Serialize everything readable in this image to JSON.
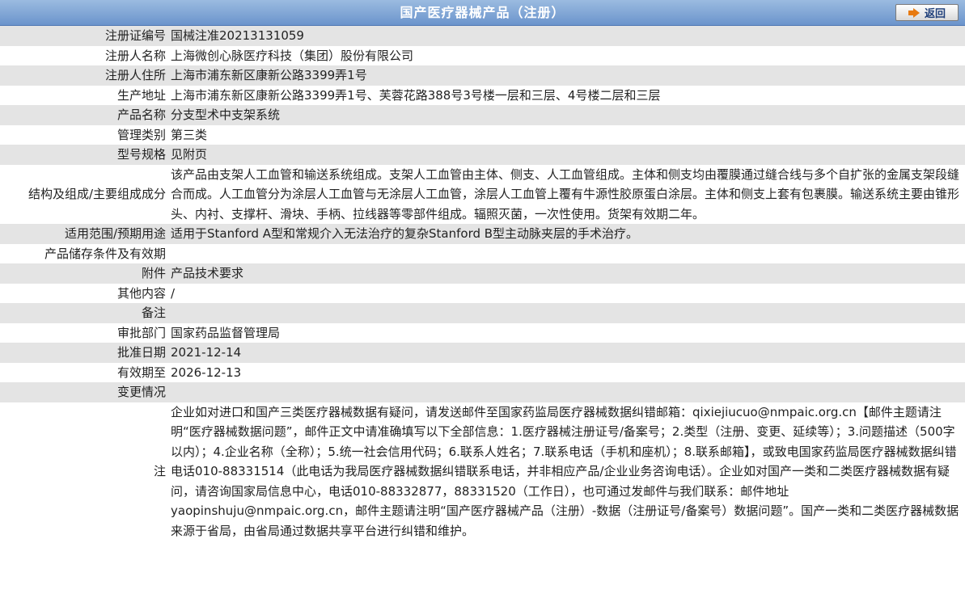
{
  "header": {
    "title": "国产医疗器械产品（注册）",
    "back_label": "返回",
    "back_icon": "arrow-right-icon"
  },
  "rows": [
    {
      "label": "注册证编号",
      "value": "国械注准20213131059"
    },
    {
      "label": "注册人名称",
      "value": "上海微创心脉医疗科技（集团）股份有限公司"
    },
    {
      "label": "注册人住所",
      "value": "上海市浦东新区康新公路3399弄1号"
    },
    {
      "label": "生产地址",
      "value": "上海市浦东新区康新公路3399弄1号、芙蓉花路388号3号楼一层和三层、4号楼二层和三层"
    },
    {
      "label": "产品名称",
      "value": "分支型术中支架系统"
    },
    {
      "label": "管理类别",
      "value": "第三类"
    },
    {
      "label": "型号规格",
      "value": "见附页"
    },
    {
      "label": "结构及组成/主要组成成分",
      "value": "该产品由支架人工血管和输送系统组成。支架人工血管由主体、侧支、人工血管组成。主体和侧支均由覆膜通过缝合线与多个自扩张的金属支架段缝合而成。人工血管分为涂层人工血管与无涂层人工血管，涂层人工血管上覆有牛源性胶原蛋白涂层。主体和侧支上套有包裹膜。输送系统主要由锥形头、内衬、支撑杆、滑块、手柄、拉线器等零部件组成。辐照灭菌，一次性使用。货架有效期二年。"
    },
    {
      "label": "适用范围/预期用途",
      "value": "适用于Stanford A型和常规介入无法治疗的复杂Stanford B型主动脉夹层的手术治疗。"
    },
    {
      "label": "产品储存条件及有效期",
      "value": ""
    },
    {
      "label": "附件",
      "value": "产品技术要求"
    },
    {
      "label": "其他内容",
      "value": "/"
    },
    {
      "label": "备注",
      "value": ""
    },
    {
      "label": "审批部门",
      "value": "国家药品监督管理局"
    },
    {
      "label": "批准日期",
      "value": "2021-12-14"
    },
    {
      "label": "有效期至",
      "value": "2026-12-13"
    },
    {
      "label": "变更情况",
      "value": ""
    }
  ],
  "footer_note": {
    "label": "注",
    "text": "企业如对进口和国产三类医疗器械数据有疑问，请发送邮件至国家药监局医疗器械数据纠错邮箱：qixiejiucuo@nmpaic.org.cn【邮件主题请注明“医疗器械数据问题”，邮件正文中请准确填写以下全部信息：1.医疗器械注册证号/备案号；2.类型（注册、变更、延续等）；3.问题描述（500字以内）；4.企业名称（全称）；5.统一社会信用代码；6.联系人姓名；7.联系电话（手机和座机）；8.联系邮箱】，或致电国家药监局医疗器械数据纠错电话010-88331514（此电话为我局医疗器械数据纠错联系电话，并非相应产品/企业业务咨询电话）。企业如对国产一类和二类医疗器械数据有疑问，请咨询国家局信息中心，电话010-88332877，88331520（工作日），也可通过发邮件与我们联系：邮件地址yaopinshuju@nmpaic.org.cn，邮件主题请注明“国产医疗器械产品（注册）-数据（注册证号/备案号）数据问题”。国产一类和二类医疗器械数据来源于省局，由省局通过数据共享平台进行纠错和维护。"
  }
}
